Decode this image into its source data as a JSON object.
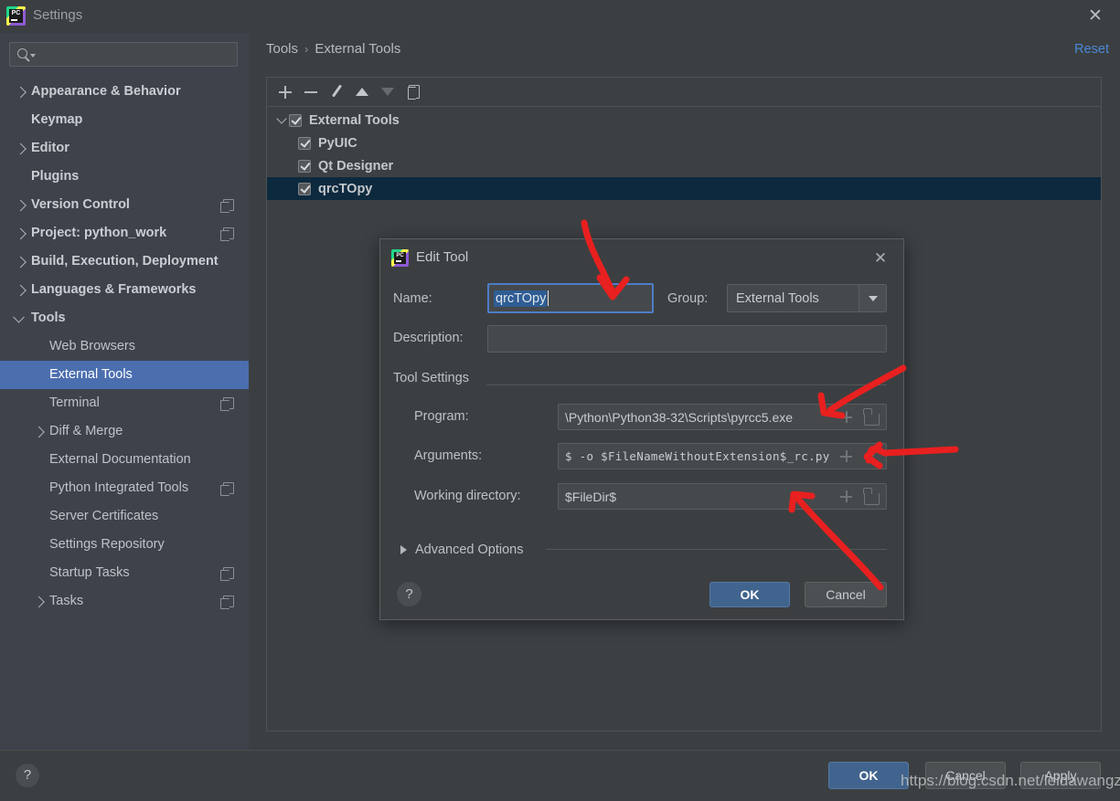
{
  "window": {
    "title": "Settings",
    "app_icon": "pycharm-logo-icon",
    "close_icon": "✕"
  },
  "search": {
    "value": "",
    "placeholder": "",
    "icon": "search-icon"
  },
  "sidebar": {
    "items": [
      {
        "label": "Appearance & Behavior",
        "level": 1,
        "expandable": true,
        "expanded": false,
        "bold": true,
        "badge": false
      },
      {
        "label": "Keymap",
        "level": 1,
        "expandable": false,
        "expanded": false,
        "bold": true,
        "badge": false
      },
      {
        "label": "Editor",
        "level": 1,
        "expandable": true,
        "expanded": false,
        "bold": true,
        "badge": false
      },
      {
        "label": "Plugins",
        "level": 1,
        "expandable": false,
        "expanded": false,
        "bold": true,
        "badge": false
      },
      {
        "label": "Version Control",
        "level": 1,
        "expandable": true,
        "expanded": false,
        "bold": true,
        "badge": true
      },
      {
        "label": "Project: python_work",
        "level": 1,
        "expandable": true,
        "expanded": false,
        "bold": true,
        "badge": true
      },
      {
        "label": "Build, Execution, Deployment",
        "level": 1,
        "expandable": true,
        "expanded": false,
        "bold": true,
        "badge": false
      },
      {
        "label": "Languages & Frameworks",
        "level": 1,
        "expandable": true,
        "expanded": false,
        "bold": true,
        "badge": false
      },
      {
        "label": "Tools",
        "level": 1,
        "expandable": true,
        "expanded": true,
        "bold": true,
        "badge": false
      },
      {
        "label": "Web Browsers",
        "level": 2,
        "expandable": false,
        "expanded": false,
        "bold": false,
        "badge": false
      },
      {
        "label": "External Tools",
        "level": 2,
        "expandable": false,
        "expanded": false,
        "bold": false,
        "badge": false,
        "selected": true
      },
      {
        "label": "Terminal",
        "level": 2,
        "expandable": false,
        "expanded": false,
        "bold": false,
        "badge": true
      },
      {
        "label": "Diff & Merge",
        "level": 2,
        "expandable": true,
        "expanded": false,
        "bold": false,
        "badge": false
      },
      {
        "label": "External Documentation",
        "level": 2,
        "expandable": false,
        "expanded": false,
        "bold": false,
        "badge": false
      },
      {
        "label": "Python Integrated Tools",
        "level": 2,
        "expandable": false,
        "expanded": false,
        "bold": false,
        "badge": true
      },
      {
        "label": "Server Certificates",
        "level": 2,
        "expandable": false,
        "expanded": false,
        "bold": false,
        "badge": false
      },
      {
        "label": "Settings Repository",
        "level": 2,
        "expandable": false,
        "expanded": false,
        "bold": false,
        "badge": false
      },
      {
        "label": "Startup Tasks",
        "level": 2,
        "expandable": false,
        "expanded": false,
        "bold": false,
        "badge": true
      },
      {
        "label": "Tasks",
        "level": 2,
        "expandable": true,
        "expanded": false,
        "bold": false,
        "badge": true
      }
    ]
  },
  "main": {
    "breadcrumb": {
      "root": "Tools",
      "separator": "›",
      "leaf": "External Tools"
    },
    "reset_label": "Reset",
    "toolbar": [
      {
        "name": "add-tool-button",
        "icon": "plus-icon",
        "enabled": true
      },
      {
        "name": "remove-tool-button",
        "icon": "minus-icon",
        "enabled": true
      },
      {
        "name": "edit-tool-button",
        "icon": "pencil-icon",
        "enabled": true
      },
      {
        "name": "move-up-button",
        "icon": "arrow-up-icon",
        "enabled": true
      },
      {
        "name": "move-down-button",
        "icon": "arrow-down-icon",
        "enabled": false
      },
      {
        "name": "copy-tool-button",
        "icon": "copy-icon",
        "enabled": true
      }
    ],
    "tree": [
      {
        "label": "External Tools",
        "level": 0,
        "checked": true,
        "expanded": true,
        "bold": true,
        "selected": false
      },
      {
        "label": "PyUIC",
        "level": 1,
        "checked": true,
        "bold": true,
        "selected": false
      },
      {
        "label": "Qt Designer",
        "level": 1,
        "checked": true,
        "bold": true,
        "selected": false
      },
      {
        "label": "qrcTOpy",
        "level": 1,
        "checked": true,
        "bold": true,
        "selected": true
      }
    ]
  },
  "dialog": {
    "title": "Edit Tool",
    "icon": "pycharm-logo-icon",
    "close_icon": "✕",
    "name_label": "Name:",
    "name_value": "qrcTOpy",
    "group_label": "Group:",
    "group_value": "External Tools",
    "description_label": "Description:",
    "description_value": "",
    "tool_settings_label": "Tool Settings",
    "program_label": "Program:",
    "program_value": "\\Python\\Python38-32\\Scripts\\pyrcc5.exe",
    "arguments_label": "Arguments:",
    "arguments_value": "$ -o $FileNameWithoutExtension$_rc.py",
    "working_dir_label": "Working directory:",
    "working_dir_value": "$FileDir$",
    "advanced_options_label": "Advanced Options",
    "help_label": "?",
    "ok_label": "OK",
    "cancel_label": "Cancel"
  },
  "footer": {
    "help_label": "?",
    "ok_label": "OK",
    "cancel_label": "Cancel",
    "apply_label": "Apply"
  },
  "watermark": "https://blog.csdn.net/leidawangzi",
  "colors": {
    "window_bg": "#3c3f41",
    "sidebar_bg": "#3e424b",
    "panel_bg": "#3c4043",
    "sidebar_selection": "#4b6eaf",
    "tree_selection": "#0d293e",
    "accent_link": "#4a88d8",
    "primary_button": "#41648e",
    "annotation_arrow": "#e8201f",
    "text": "#bdc3c7"
  },
  "annotations": {
    "arrow_color": "#e8201f",
    "count": 3
  }
}
